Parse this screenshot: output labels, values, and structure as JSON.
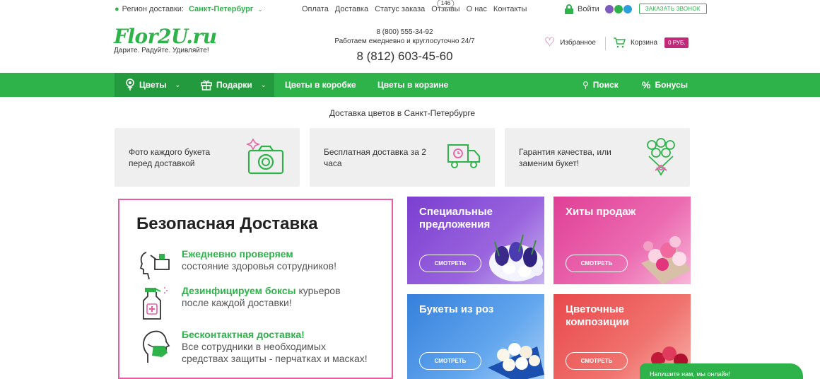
{
  "topbar": {
    "region_label": "Регион доставки:",
    "city": "Санкт-Петербург",
    "links": [
      "Оплата",
      "Доставка",
      "Статус заказа",
      "Отзывы",
      "О нас",
      "Контакты"
    ],
    "reviews_count": "146",
    "login": "Войти",
    "callback": "ЗАКАЗАТЬ ЗВОНОК"
  },
  "header": {
    "logo": "Flor2U.ru",
    "tagline": "Дарите. Радуйте. Удивляйте!",
    "phone_free": "8 (800) 555-34-92",
    "hours": "Работаем ежедневно и круглосуточно 24/7",
    "phone_city": "8 (812) 603-45-60",
    "favorites": "Избранное",
    "cart": "Корзина",
    "cart_total": "0 РУБ."
  },
  "nav": {
    "flowers": "Цветы",
    "gifts": "Подарки",
    "box": "Цветы в коробке",
    "basket": "Цветы в корзине",
    "search": "Поиск",
    "bonus": "Бонусы"
  },
  "subtitle": "Доставка цветов в Санкт-Петербурге",
  "features": [
    {
      "text": "Фото каждого букета перед доставкой",
      "icon": "camera-icon"
    },
    {
      "text": "Бесплатная доставка за 2 часа",
      "icon": "truck-icon"
    },
    {
      "text": "Гарантия качества, или заменим букет!",
      "icon": "bouquet-icon"
    }
  ],
  "safe": {
    "title": "Безопасная Доставка",
    "r1_hl": "Ежедневно проверяем",
    "r1_text": "состояние здоровья сотрудников!",
    "r2_hl": "Дезинфицируем боксы",
    "r2_text1": " курьеров",
    "r2_text2": "после каждой доставки!",
    "r3_hl": "Бесконтактная доставка!",
    "r3_text1": "Все сотрудники в необходимых",
    "r3_text2": "средствах защиты - перчатках и масках!"
  },
  "tiles": [
    {
      "title": "Специальные предложения",
      "button": "СМОТРЕТЬ",
      "color": "#8a4fd8"
    },
    {
      "title": "Хиты продаж",
      "button": "СМОТРЕТЬ",
      "color": "#e3479c"
    },
    {
      "title": "Букеты из роз",
      "button": "СМОТРЕТЬ",
      "color": "#3f8fe0"
    },
    {
      "title": "Цветочные композиции",
      "button": "СМОТРЕТЬ",
      "color": "#ef5f5f"
    }
  ],
  "chat": "Напишите нам, мы онлайн!",
  "colors": {
    "brand_green": "#2eb34a",
    "accent_pink": "#c2297a"
  }
}
